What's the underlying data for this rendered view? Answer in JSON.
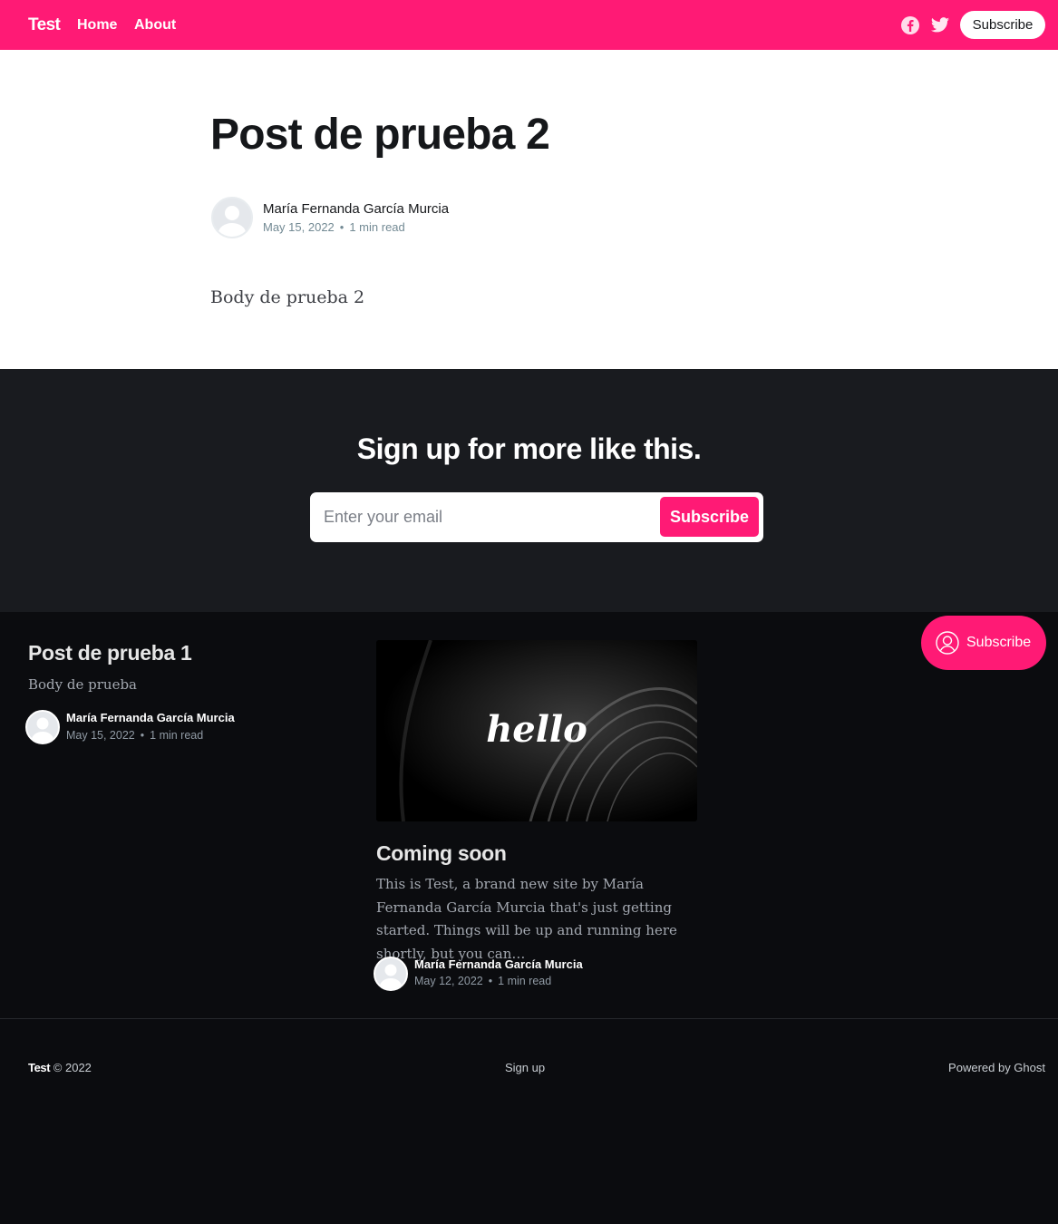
{
  "header": {
    "brand": "Test",
    "nav": [
      {
        "label": "Home"
      },
      {
        "label": "About"
      }
    ],
    "subscribe_label": "Subscribe",
    "icons": [
      "facebook-icon",
      "twitter-icon"
    ],
    "accent_color": "#ff1a75"
  },
  "article": {
    "title": "Post de prueba 2",
    "author": "María Fernanda García Murcia",
    "date": "May 15, 2022",
    "reading_time": "1 min read",
    "body": "Body de prueba 2"
  },
  "signup": {
    "title": "Sign up for more like this.",
    "email_placeholder": "Enter your email",
    "submit_label": "Subscribe"
  },
  "feed": {
    "posts": [
      {
        "title": "Post de prueba 1",
        "excerpt": "Body de prueba",
        "author": "María Fernanda García Murcia",
        "date": "May 15, 2022",
        "reading_time": "1 min read"
      },
      {
        "title": "Coming soon",
        "image_text": "hello",
        "excerpt": "This is Test, a brand new site by María Fernanda García Murcia that's just getting started. Things will be up and running here shortly, but you can…",
        "author": "María Fernanda García Murcia",
        "date": "May 12, 2022",
        "reading_time": "1 min read"
      }
    ]
  },
  "portal": {
    "label": "Subscribe"
  },
  "footer": {
    "brand": "Test",
    "copyright": "© 2022",
    "signup_link": "Sign up",
    "powered_by": "Powered by Ghost"
  }
}
